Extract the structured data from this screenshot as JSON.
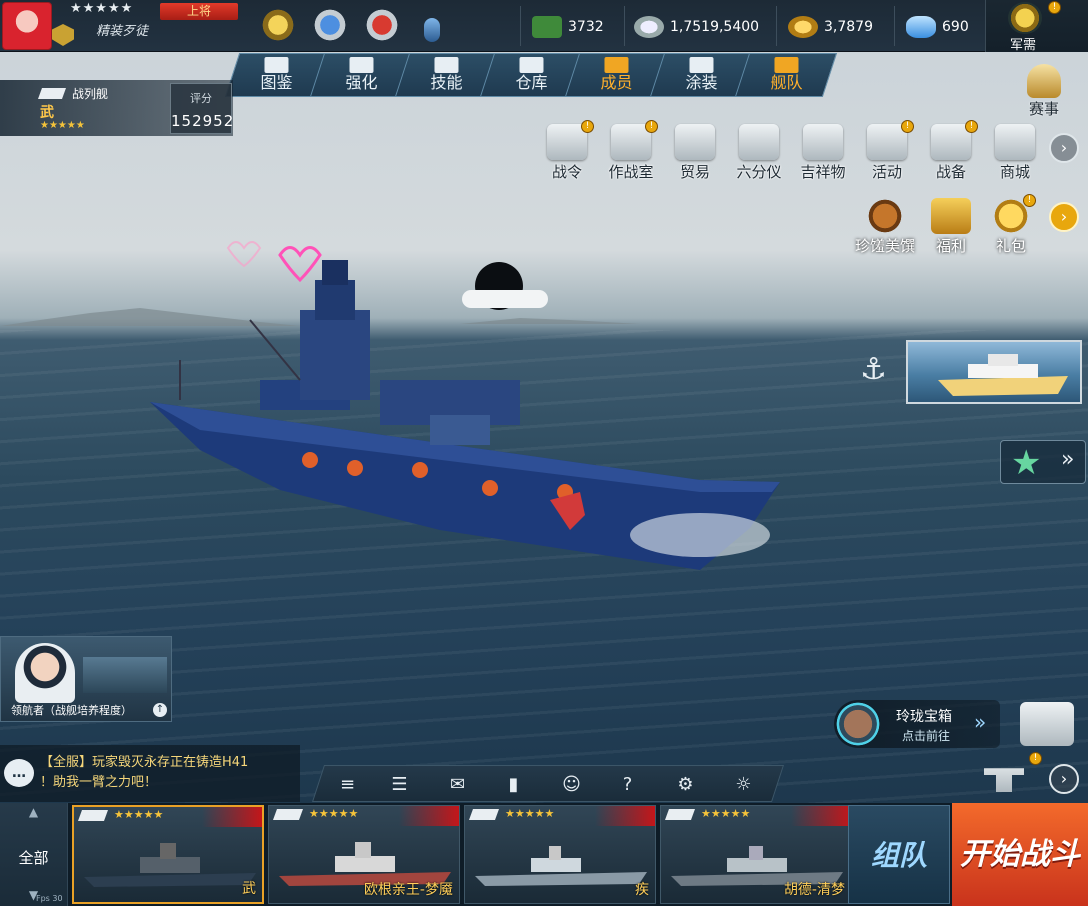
{
  "player": {
    "stars": "★★★★★",
    "rank": "上将",
    "name": "精装歹徒"
  },
  "resources": [
    {
      "icon": "cash-icon",
      "value": "3732"
    },
    {
      "icon": "silver-coin-icon",
      "value": "1,7519,5400"
    },
    {
      "icon": "gold-coin-icon",
      "value": "3,7879"
    },
    {
      "icon": "diamond-icon",
      "value": "690"
    }
  ],
  "military_supply": {
    "label": "军需",
    "badge": "!"
  },
  "tabs": [
    {
      "label": "图鉴",
      "icon": "book-icon"
    },
    {
      "label": "强化",
      "icon": "upgrade-icon"
    },
    {
      "label": "技能",
      "icon": "skill-icon"
    },
    {
      "label": "仓库",
      "icon": "warehouse-icon"
    },
    {
      "label": "成员",
      "icon": "crew-icon"
    },
    {
      "label": "涂装",
      "icon": "paint-flag-icon"
    },
    {
      "label": "舰队",
      "icon": "fleet-icon"
    }
  ],
  "ship_info": {
    "class": "战列舰",
    "name": "武",
    "stars": "★★★★★",
    "score_label": "评分",
    "score": "152952"
  },
  "events": {
    "label": "赛事"
  },
  "menu_row1": [
    {
      "label": "战令",
      "icon": "battle-pass-icon",
      "badge": "!"
    },
    {
      "label": "作战室",
      "icon": "map-room-icon",
      "badge": "!"
    },
    {
      "label": "贸易",
      "icon": "trade-scale-icon"
    },
    {
      "label": "六分仪",
      "icon": "sextant-icon"
    },
    {
      "label": "吉祥物",
      "icon": "mascot-icon"
    },
    {
      "label": "活动",
      "icon": "horn-icon",
      "badge": "!"
    },
    {
      "label": "战备",
      "icon": "supplies-icon",
      "badge": "!"
    },
    {
      "label": "商城",
      "icon": "shop-cart-icon"
    }
  ],
  "menu_row2": [
    {
      "label": "珍馐美馔",
      "icon": "roast-chicken-icon"
    },
    {
      "label": "福利",
      "icon": "treasure-chest-icon"
    },
    {
      "label": "礼包",
      "icon": "gold-bag-icon",
      "badge": "!"
    }
  ],
  "navigator": {
    "label": "领航者（战舰培养程度）"
  },
  "chat": {
    "message_line1": "【全服】玩家毁灭永存正在铸造H41",
    "message_line2": "！助我一臂之力吧！"
  },
  "treasure": {
    "title": "玲珑宝箱",
    "subtitle": "点击前往"
  },
  "ship_list": {
    "all_label": "全部",
    "fps": "Fps 30",
    "ships": [
      {
        "name": "武",
        "stars": "★★★★★"
      },
      {
        "name": "欧根亲王-梦魇",
        "stars": "★★★★★"
      },
      {
        "name": "疾",
        "stars": "★★★★★"
      },
      {
        "name": "胡德-清梦",
        "stars": "★★★★★"
      }
    ]
  },
  "buttons": {
    "team": "组队",
    "start": "开始战斗"
  },
  "colors": {
    "accent_orange": "#e9a126",
    "start_red": "#d9411f",
    "sea": "#2c4a5e",
    "ship_hull": "#1d3a7a"
  }
}
